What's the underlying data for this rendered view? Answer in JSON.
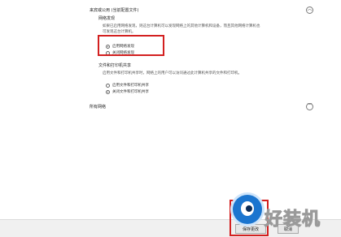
{
  "section": {
    "title": "来宾或公用 (当前配置文件)",
    "collapse_icon": "chevron-up-icon"
  },
  "network_discovery": {
    "heading": "网络发现",
    "description_line1": "如果已启用网络发现，则这台计算机可以发现网络上的其他计算机和设备，而且其他网络计算机也",
    "description_line2": "可发现这台计算机。",
    "options": [
      {
        "label": "启用网络发现",
        "selected": true
      },
      {
        "label": "关闭网络发现",
        "selected": false
      }
    ]
  },
  "file_printer_sharing": {
    "heading": "文件和打印机共享",
    "description": "启用文件和打印机共享时，网络上的用户可以访问通过此计算机共享的文件和打印机。",
    "options": [
      {
        "label": "启用文件和打印机共享",
        "selected": false
      },
      {
        "label": "关闭文件和打印机共享",
        "selected": true
      }
    ]
  },
  "all_networks": {
    "title": "所有网络",
    "expand_icon": "chevron-down-icon"
  },
  "footer": {
    "save_label": "保存更改",
    "cancel_label": "取消"
  },
  "watermark": {
    "text": "好装机"
  },
  "colors": {
    "highlight": "#d32020",
    "brand_blue": "#1b75cf"
  }
}
